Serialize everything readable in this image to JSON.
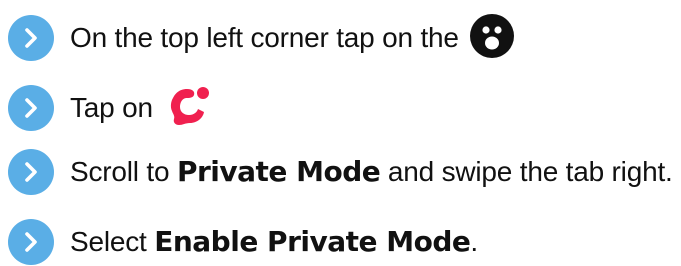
{
  "steps": [
    {
      "text": "On the top left corner tap on the",
      "trailing_icon": "face-avatar-icon"
    },
    {
      "text": "Tap on",
      "trailing_icon": "brand-logo-icon"
    },
    {
      "text_before": "Scroll to",
      "bold": "Private Mode",
      "text_after": "and swipe the tab right."
    },
    {
      "text_before": "Select",
      "bold": "Enable Private Mode",
      "text_after": "."
    }
  ],
  "step_badge_icon": "chevron-right-icon",
  "colors": {
    "badge": "#5aaee6",
    "text": "#111111",
    "brand_logo": "#f0204f"
  }
}
